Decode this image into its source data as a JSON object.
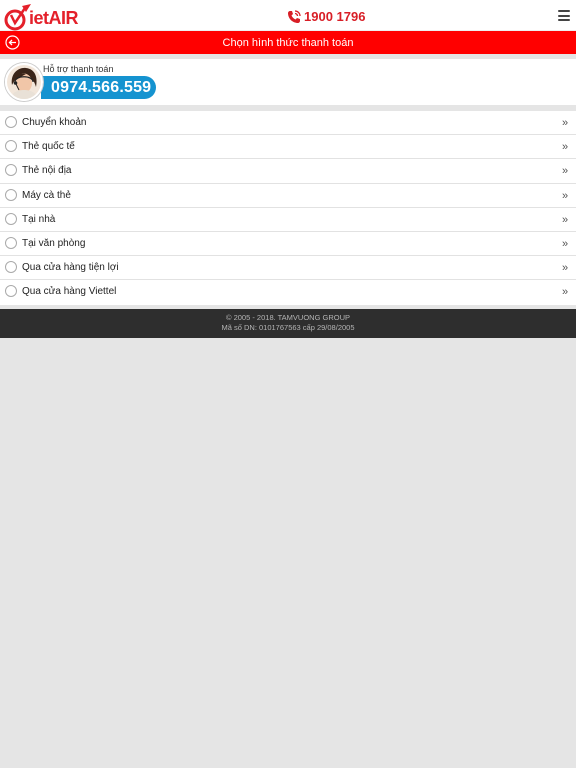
{
  "header": {
    "logo_text": "ietAIR",
    "phone": "1900 1796"
  },
  "titlebar": {
    "title": "Chọn hình thức thanh toán"
  },
  "support": {
    "label": "Hỗ trợ thanh toán",
    "hotline": "0974.566.559"
  },
  "payment_methods": [
    {
      "label": "Chuyển khoản"
    },
    {
      "label": "Thẻ quốc tế"
    },
    {
      "label": "Thẻ nội địa"
    },
    {
      "label": "Máy cà thẻ"
    },
    {
      "label": "Tại nhà"
    },
    {
      "label": "Tại văn phòng"
    },
    {
      "label": "Qua cửa hàng tiện lợi"
    },
    {
      "label": "Qua cửa hàng Viettel"
    }
  ],
  "footer": {
    "line1": "© 2005 - 2018. TAMVUONG GROUP",
    "line2": "Mã số DN: 0101767563 cấp 29/08/2005"
  },
  "colors": {
    "brand_red": "#ff0000",
    "hotline_blue": "#1593d0",
    "footer_bg": "#2e2e2e"
  }
}
